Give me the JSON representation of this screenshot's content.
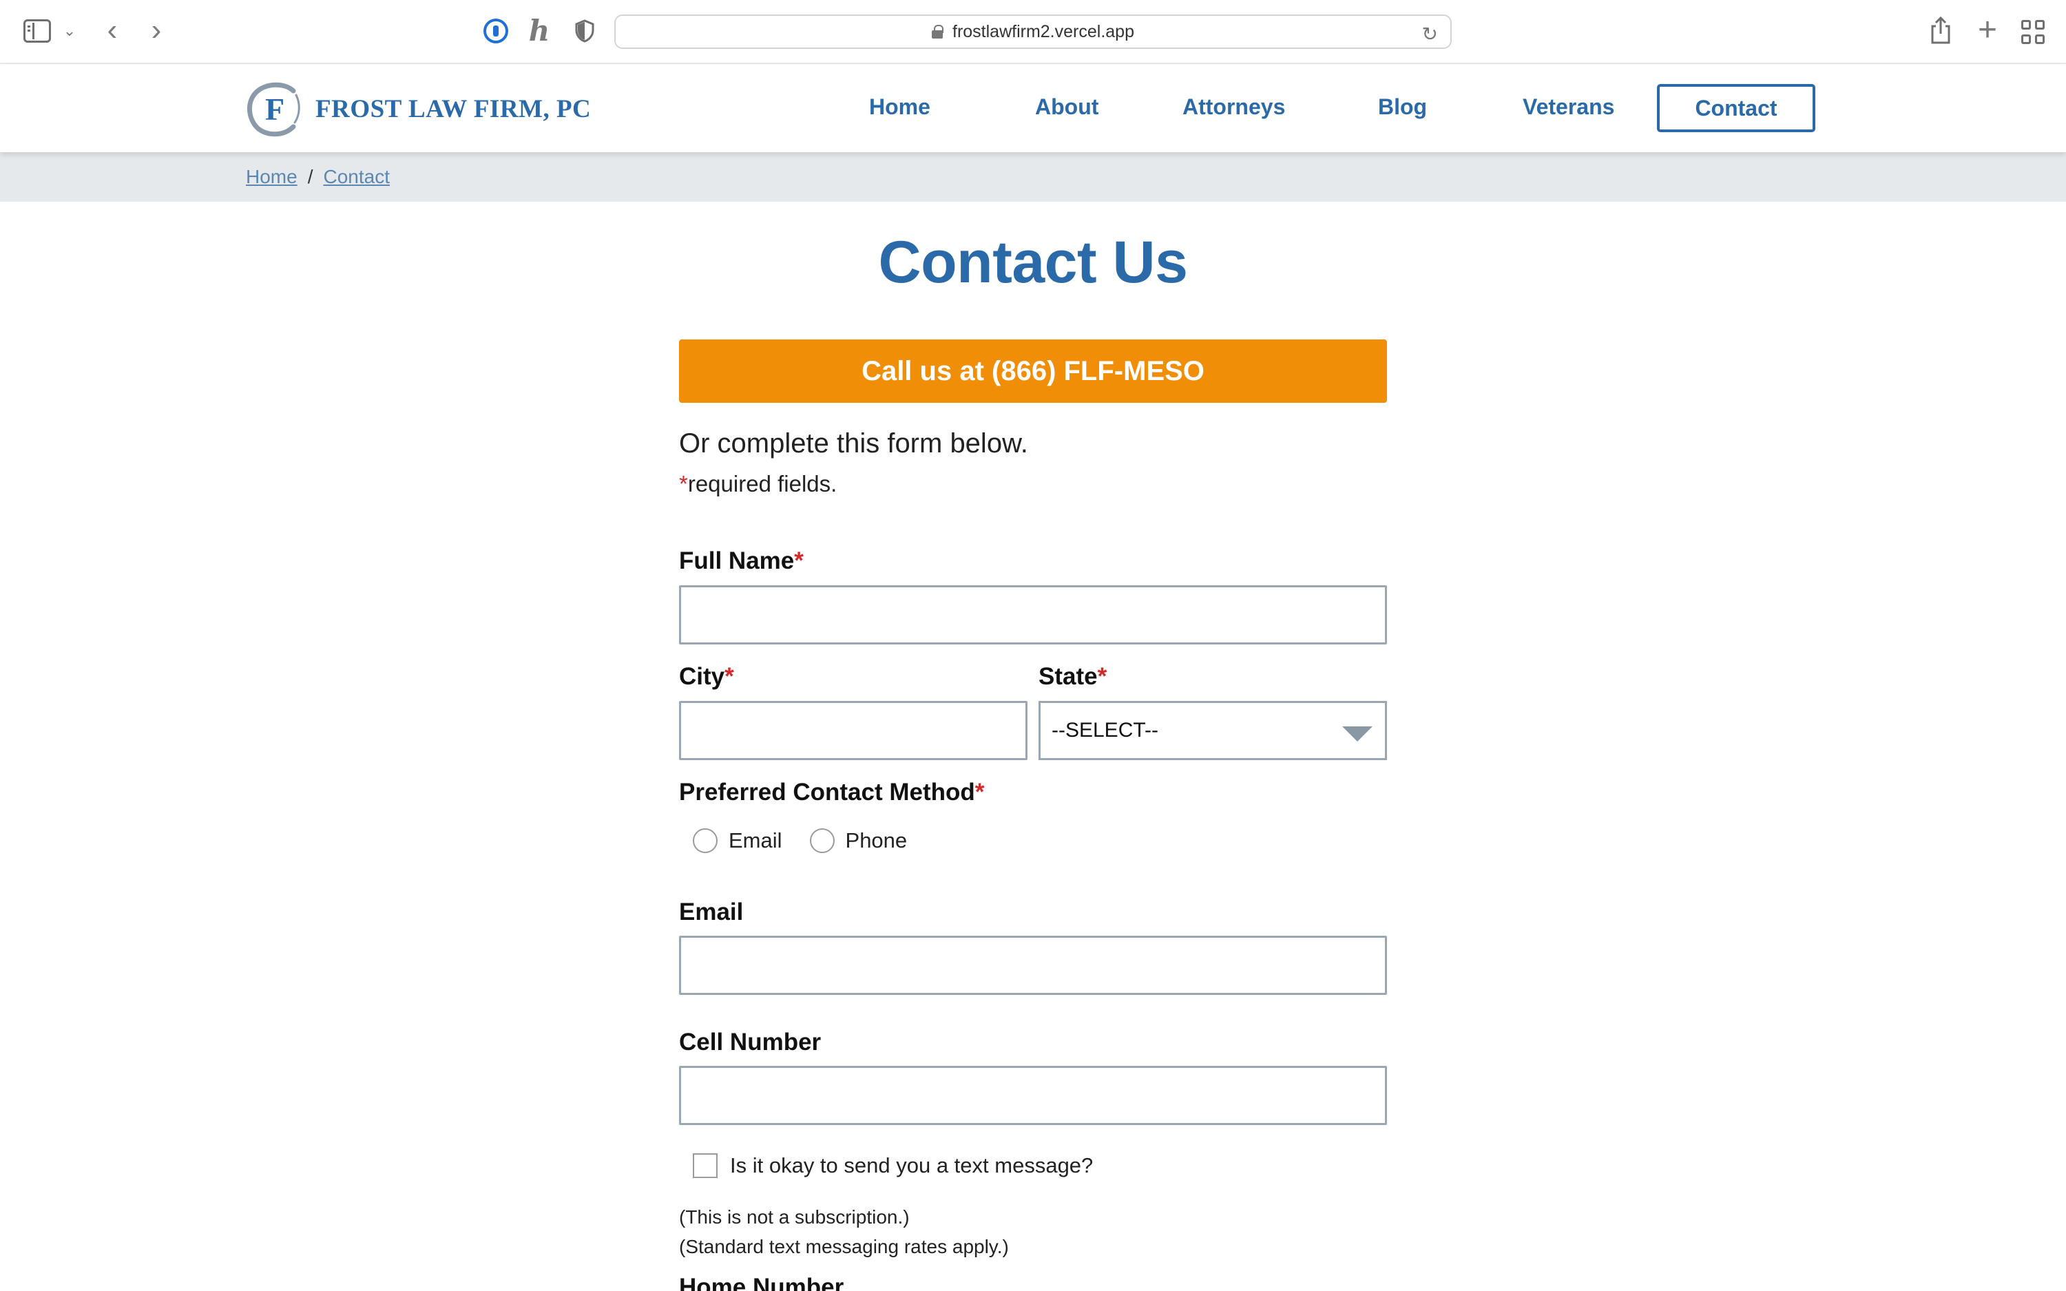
{
  "browser": {
    "url": "frostlawfirm2.vercel.app"
  },
  "header": {
    "logo_letter": "F",
    "logo_text": "FROST LAW FIRM, PC",
    "nav": {
      "home": "Home",
      "about": "About",
      "attorneys": "Attorneys",
      "blog": "Blog",
      "veterans": "Veterans",
      "contact": "Contact"
    }
  },
  "breadcrumb": {
    "home": "Home",
    "separator": "/",
    "current": "Contact"
  },
  "main": {
    "title": "Contact Us",
    "call_button": "Call us at (866) FLF-MESO",
    "intro": "Or complete this form below.",
    "required_star": "*",
    "required_note": "required fields."
  },
  "form": {
    "full_name_label": "Full Name",
    "full_name_value": "",
    "city_label": "City",
    "city_value": "",
    "state_label": "State",
    "state_selected": "--SELECT--",
    "contact_method_label": "Preferred Contact Method",
    "contact_method_options": [
      "Email",
      "Phone"
    ],
    "email_label": "Email",
    "email_value": "",
    "cell_label": "Cell Number",
    "cell_value": "",
    "text_ok_label": "Is it okay to send you a text message?",
    "note_subscription": "(This is not a subscription.)",
    "note_rates": "(Standard text messaging rates apply.)",
    "home_number_label": "Home Number"
  },
  "colors": {
    "brand_blue": "#2a6aa8",
    "call_orange": "#f08f07",
    "required_red": "#d62828",
    "breadcrumb_bg": "#e6e9ec"
  }
}
